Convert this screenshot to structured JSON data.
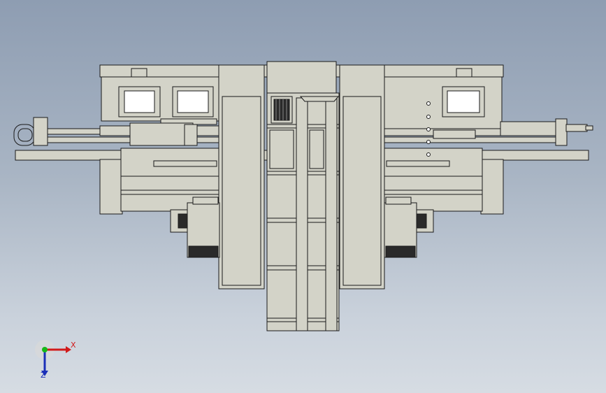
{
  "viewport": {
    "background_top": "#8e9db2",
    "background_bottom": "#d6dce3"
  },
  "model": {
    "fill_color": "#d3d3c8",
    "edge_color": "#1a1a1a",
    "dark_part_color": "#2a2a2a"
  },
  "triad": {
    "x_label": "X",
    "z_label": "Z",
    "x_color": "#d11a1a",
    "y_color": "#17b817",
    "z_color": "#1a2fb8"
  }
}
